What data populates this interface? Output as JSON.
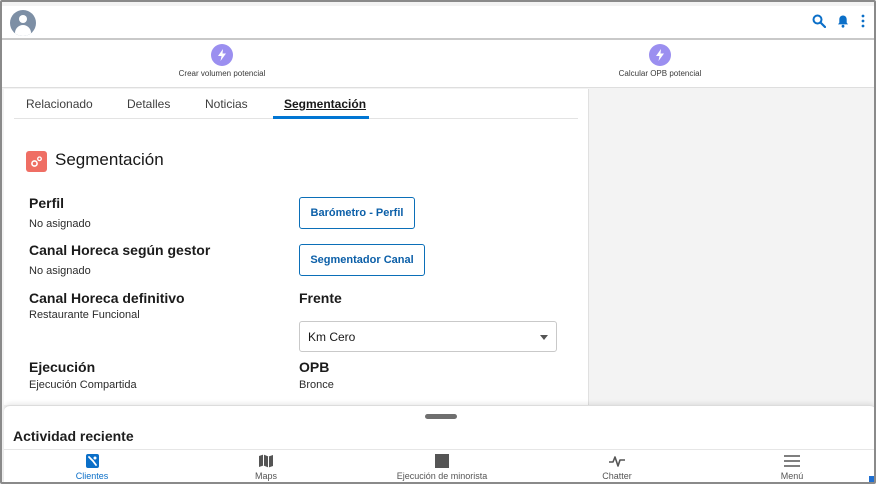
{
  "colors": {
    "accent": "#0176d3",
    "action_icon_bg": "#9b8ff0",
    "section_icon_bg": "#ef6e64",
    "link_blue": "#0b5fa8"
  },
  "topbar": {
    "icons": [
      "avatar-icon",
      "search-icon",
      "bell-icon",
      "more-vertical-icon"
    ]
  },
  "actions": [
    {
      "label": "Crear volumen potencial",
      "icon": "bolt-icon"
    },
    {
      "label": "Calcular OPB potencial",
      "icon": "bolt-icon"
    }
  ],
  "tabs": [
    {
      "label": "Relacionado"
    },
    {
      "label": "Detalles"
    },
    {
      "label": "Noticias"
    },
    {
      "label": "Segmentación",
      "active": true
    }
  ],
  "section": {
    "title": "Segmentación",
    "icon": "segmentation-gear-icon"
  },
  "fields": {
    "perfil": {
      "label": "Perfil",
      "value": "No asignado"
    },
    "canal_gestor": {
      "label": "Canal Horeca según gestor",
      "value": "No asignado"
    },
    "canal_definitivo": {
      "label": "Canal Horeca definitivo",
      "value": "Restaurante Funcional"
    },
    "ejecucion": {
      "label": "Ejecución",
      "value": "Ejecución Compartida"
    },
    "frente": {
      "label": "Frente",
      "selected": "Km Cero"
    },
    "opb": {
      "label": "OPB",
      "value": "Bronce"
    }
  },
  "buttons": {
    "barometro": "Barómetro - Perfil",
    "segmentador": "Segmentador Canal"
  },
  "drawer": {
    "title": "Actividad reciente"
  },
  "bottom_nav": [
    {
      "label": "Clientes",
      "icon": "clientes-icon",
      "active": true
    },
    {
      "label": "Maps",
      "icon": "map-icon"
    },
    {
      "label": "Ejecución de minorista",
      "icon": "retail-execution-icon"
    },
    {
      "label": "Chatter",
      "icon": "pulse-icon"
    },
    {
      "label": "Menú",
      "icon": "hamburger-icon"
    }
  ]
}
